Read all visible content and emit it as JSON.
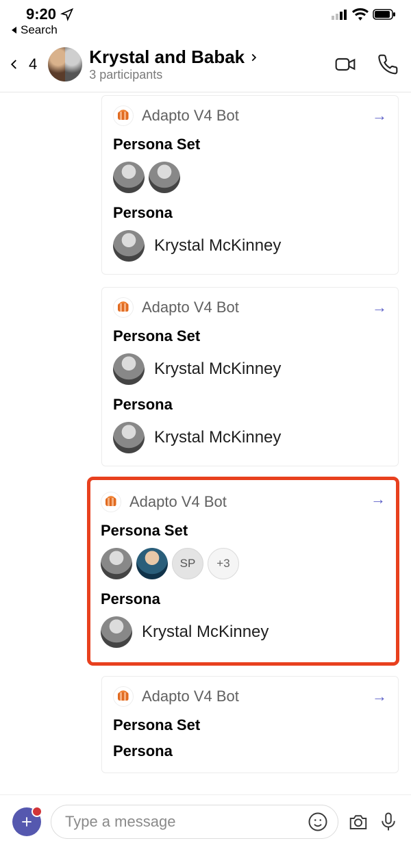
{
  "status": {
    "time": "9:20",
    "back_label": "Search"
  },
  "header": {
    "unread_count": "4",
    "title": "Krystal and Babak",
    "subtitle": "3 participants"
  },
  "bot_name": "Adapto V4 Bot",
  "labels": {
    "persona_set": "Persona Set",
    "persona": "Persona"
  },
  "cards": [
    {
      "persona_name": "Krystal McKinney",
      "set_avatars": [
        "bw",
        "bw"
      ],
      "highlight": false
    },
    {
      "persona_name": "Krystal McKinney",
      "set_avatars": [],
      "set_labeled": "Krystal McKinney",
      "highlight": false
    },
    {
      "persona_name": "Krystal McKinney",
      "set_avatars": [
        "bw",
        "color",
        "SP",
        "+3"
      ],
      "highlight": true
    },
    {
      "persona_name": "",
      "set_avatars": [],
      "highlight": false,
      "truncated": true
    }
  ],
  "card2_set_name": "Krystal McKinney",
  "card3_overflow": "+3",
  "card3_initials": "SP",
  "composer": {
    "placeholder": "Type a message"
  }
}
